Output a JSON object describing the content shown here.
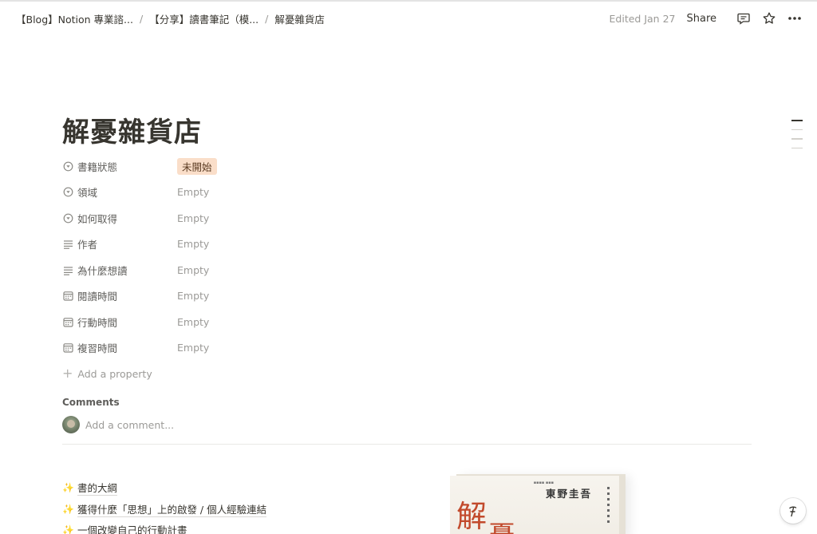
{
  "breadcrumb": [
    {
      "label": "【Blog】Notion 專業諮..."
    },
    {
      "label": "【分享】讀書筆記（模..."
    },
    {
      "label": "解憂雜貨店"
    }
  ],
  "breadcrumb_separator": "/",
  "header": {
    "edited": "Edited Jan 27",
    "share_label": "Share",
    "icons": [
      "comment-icon",
      "star-icon",
      "more-icon"
    ]
  },
  "page": {
    "title": "解憂雜貨店"
  },
  "properties": [
    {
      "icon": "select-icon",
      "name": "書籍狀態",
      "value": "未開始",
      "type": "tag",
      "tag_color": "#fadec9"
    },
    {
      "icon": "select-icon",
      "name": "領域",
      "value": "Empty",
      "type": "empty"
    },
    {
      "icon": "select-icon",
      "name": "如何取得",
      "value": "Empty",
      "type": "empty"
    },
    {
      "icon": "text-icon",
      "name": "作者",
      "value": "Empty",
      "type": "empty"
    },
    {
      "icon": "text-icon",
      "name": "為什麼想讀",
      "value": "Empty",
      "type": "empty"
    },
    {
      "icon": "calendar-icon",
      "name": "閱讀時間",
      "value": "Empty",
      "type": "empty"
    },
    {
      "icon": "calendar-icon",
      "name": "行動時間",
      "value": "Empty",
      "type": "empty"
    },
    {
      "icon": "calendar-icon",
      "name": "複習時間",
      "value": "Empty",
      "type": "empty"
    }
  ],
  "add_property_label": "Add a property",
  "comments": {
    "label": "Comments",
    "placeholder": "Add a comment..."
  },
  "content_links": [
    {
      "icon": "sparkle-icon",
      "text": "書的大綱"
    },
    {
      "icon": "sparkle-icon",
      "text": "獲得什麼「思想」上的啟發 / 個人經驗連結"
    },
    {
      "icon": "sparkle-icon",
      "text": "一個改變自己的行動計畫"
    }
  ],
  "book_cover": {
    "title_chars": [
      "解",
      "憂"
    ],
    "author": "東野圭吾"
  }
}
